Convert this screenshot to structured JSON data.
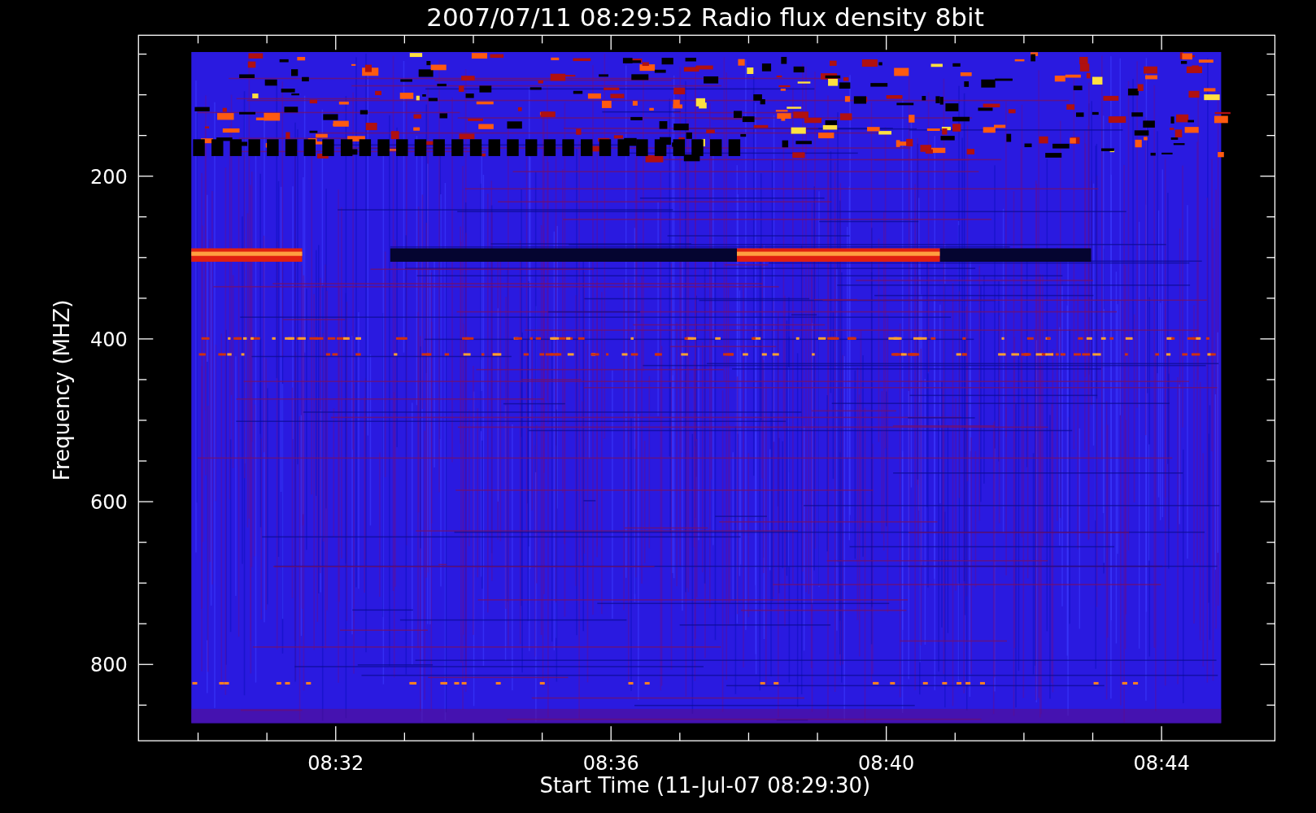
{
  "title": "2007/07/11 08:29:52 Radio flux density 8bit",
  "ylabel": "Frequency (MHZ)",
  "xlabel": "Start Time (11-Jul-07 08:29:30)",
  "yticks": [
    "200",
    "400",
    "600",
    "800"
  ],
  "xticks": [
    "08:32",
    "08:36",
    "08:40",
    "08:44"
  ]
}
